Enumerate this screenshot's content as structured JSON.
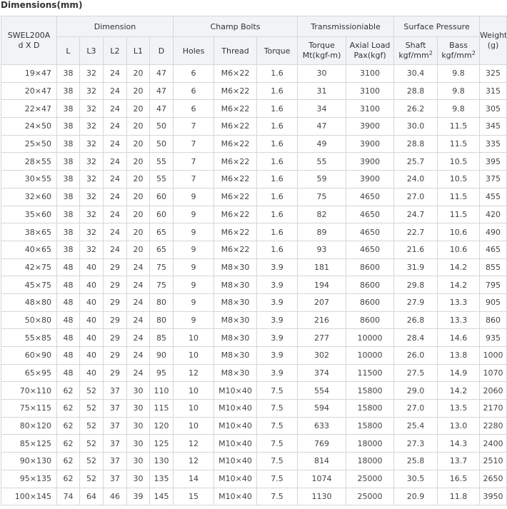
{
  "title": "Dimensions(mm)",
  "header": {
    "model": "SWEL200A",
    "model_sub": "d X D",
    "dimension": "Dimension",
    "champ_bolts": "Champ Bolts",
    "transmission": "Transmissioniable",
    "surface_pressure": "Surface Pressure",
    "weight": "Weight",
    "weight_unit": "(g)",
    "L": "L",
    "L3": "L3",
    "L2": "L2",
    "L1": "L1",
    "D": "D",
    "holes": "Holes",
    "thread": "Thread",
    "torque": "Torque",
    "torque_mt": "Torque",
    "torque_mt_unit": "Mt(kgf-m)",
    "axial_load": "Axial Load",
    "axial_load_unit": "Pax(kgf)",
    "shaft": "Shaft",
    "shaft_unit": "kgf/mm",
    "shaft_sup": "2",
    "bass": "Bass",
    "bass_unit": "kgf/mm",
    "bass_sup": "2"
  },
  "rows": [
    [
      "19×47",
      "38",
      "32",
      "24",
      "20",
      "47",
      "6",
      "M6×22",
      "1.6",
      "30",
      "3100",
      "30.4",
      "9.8",
      "325"
    ],
    [
      "20×47",
      "38",
      "32",
      "24",
      "20",
      "47",
      "6",
      "M6×22",
      "1.6",
      "31",
      "3100",
      "28.8",
      "9.8",
      "315"
    ],
    [
      "22×47",
      "38",
      "32",
      "24",
      "20",
      "47",
      "6",
      "M6×22",
      "1.6",
      "34",
      "3100",
      "26.2",
      "9.8",
      "305"
    ],
    [
      "24×50",
      "38",
      "32",
      "24",
      "20",
      "50",
      "7",
      "M6×22",
      "1.6",
      "47",
      "3900",
      "30.0",
      "11.5",
      "345"
    ],
    [
      "25×50",
      "38",
      "32",
      "24",
      "20",
      "50",
      "7",
      "M6×22",
      "1.6",
      "49",
      "3900",
      "28.8",
      "11.5",
      "335"
    ],
    [
      "28×55",
      "38",
      "32",
      "24",
      "20",
      "55",
      "7",
      "M6×22",
      "1.6",
      "55",
      "3900",
      "25.7",
      "10.5",
      "395"
    ],
    [
      "30×55",
      "38",
      "32",
      "24",
      "20",
      "55",
      "7",
      "M6×22",
      "1.6",
      "59",
      "3900",
      "24.0",
      "10.5",
      "375"
    ],
    [
      "32×60",
      "38",
      "32",
      "24",
      "20",
      "60",
      "9",
      "M6×22",
      "1.6",
      "75",
      "4650",
      "27.0",
      "11.5",
      "455"
    ],
    [
      "35×60",
      "38",
      "32",
      "24",
      "20",
      "60",
      "9",
      "M6×22",
      "1.6",
      "82",
      "4650",
      "24.7",
      "11.5",
      "420"
    ],
    [
      "38×65",
      "38",
      "32",
      "24",
      "20",
      "65",
      "9",
      "M6×22",
      "1.6",
      "89",
      "4650",
      "22.7",
      "10.6",
      "490"
    ],
    [
      "40×65",
      "38",
      "32",
      "24",
      "20",
      "65",
      "9",
      "M6×22",
      "1.6",
      "93",
      "4650",
      "21.6",
      "10.6",
      "465"
    ],
    [
      "42×75",
      "48",
      "40",
      "29",
      "24",
      "75",
      "9",
      "M8×30",
      "3.9",
      "181",
      "8600",
      "31.9",
      "14.2",
      "855"
    ],
    [
      "45×75",
      "48",
      "40",
      "29",
      "24",
      "75",
      "9",
      "M8×30",
      "3.9",
      "194",
      "8600",
      "29.8",
      "14.2",
      "795"
    ],
    [
      "48×80",
      "48",
      "40",
      "29",
      "24",
      "80",
      "9",
      "M8×30",
      "3.9",
      "207",
      "8600",
      "27.9",
      "13.3",
      "905"
    ],
    [
      "50×80",
      "48",
      "40",
      "29",
      "24",
      "80",
      "9",
      "M8×30",
      "3.9",
      "216",
      "8600",
      "26.8",
      "13.3",
      "860"
    ],
    [
      "55×85",
      "48",
      "40",
      "29",
      "24",
      "85",
      "10",
      "M8×30",
      "3.9",
      "277",
      "10000",
      "28.4",
      "14.6",
      "935"
    ],
    [
      "60×90",
      "48",
      "40",
      "29",
      "24",
      "90",
      "10",
      "M8×30",
      "3.9",
      "302",
      "10000",
      "26.0",
      "13.8",
      "1000"
    ],
    [
      "65×95",
      "48",
      "40",
      "29",
      "24",
      "95",
      "12",
      "M8×30",
      "3.9",
      "374",
      "11500",
      "27.5",
      "14.9",
      "1070"
    ],
    [
      "70×110",
      "62",
      "52",
      "37",
      "30",
      "110",
      "10",
      "M10×40",
      "7.5",
      "554",
      "15800",
      "29.0",
      "14.2",
      "2060"
    ],
    [
      "75×115",
      "62",
      "52",
      "37",
      "30",
      "115",
      "10",
      "M10×40",
      "7.5",
      "594",
      "15800",
      "27.0",
      "13.5",
      "2170"
    ],
    [
      "80×120",
      "62",
      "52",
      "37",
      "30",
      "120",
      "10",
      "M10×40",
      "7.5",
      "633",
      "15800",
      "25.4",
      "13.0",
      "2280"
    ],
    [
      "85×125",
      "62",
      "52",
      "37",
      "30",
      "125",
      "12",
      "M10×40",
      "7.5",
      "769",
      "18000",
      "27.3",
      "14.3",
      "2400"
    ],
    [
      "90×130",
      "62",
      "52",
      "37",
      "30",
      "130",
      "12",
      "M10×40",
      "7.5",
      "814",
      "18000",
      "25.8",
      "13.7",
      "2510"
    ],
    [
      "95×135",
      "62",
      "52",
      "37",
      "30",
      "135",
      "14",
      "M10×40",
      "7.5",
      "1074",
      "25000",
      "30.5",
      "16.5",
      "2650"
    ],
    [
      "100×145",
      "74",
      "64",
      "46",
      "39",
      "145",
      "15",
      "M10×40",
      "7.5",
      "1130",
      "25000",
      "20.9",
      "11.8",
      "3950"
    ]
  ]
}
